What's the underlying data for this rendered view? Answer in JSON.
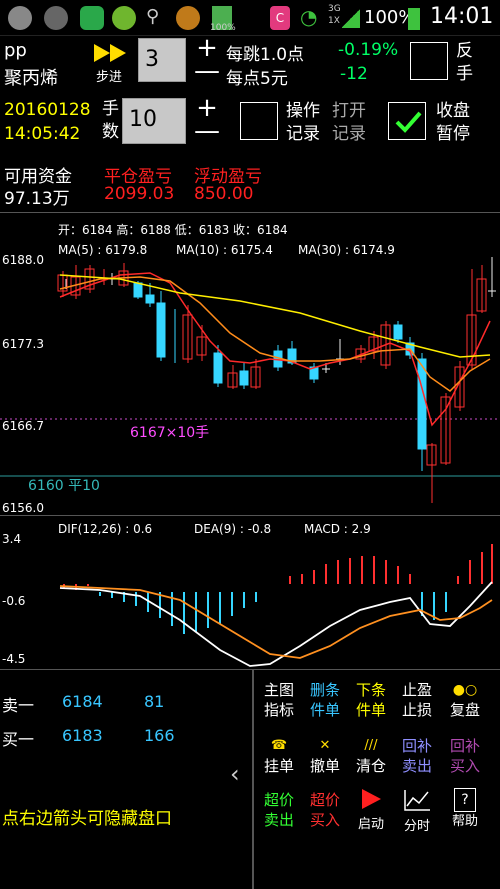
{
  "status_bar": {
    "battery_small": "100%",
    "network": "3G",
    "network_sub": "1X",
    "battery": "100%",
    "time": "14:01"
  },
  "header": {
    "symbol": "pp",
    "name": "聚丙烯",
    "step_label": "步进",
    "step_value": "3",
    "tick_info": "每跳1.0点",
    "point_info": "每点5元",
    "change_pct": "-0.19%",
    "change_abs": "-12",
    "reverse_label": "反\n手",
    "date": "20160128",
    "time": "14:05:42",
    "lots_label": "手\n数",
    "lots_value": "10",
    "op_record_label": "操作\n记录",
    "open_record_label": "打开\n记录",
    "pause_label": "收盘\n暂停"
  },
  "account": {
    "avail_label": "可用资金",
    "avail_value": "97.13万",
    "closed_pnl_label": "平仓盈亏",
    "closed_pnl_value": "2099.03",
    "float_pnl_label": "浮动盈亏",
    "float_pnl_value": "850.00"
  },
  "kline": {
    "ohlc": "开：6184    高：6188    低：6183    收：6184",
    "ma5": "MA(5) : 6179.8",
    "ma10": "MA(10) : 6175.4",
    "ma30": "MA(30) : 6174.9",
    "y_labels": [
      "6188.0",
      "6177.3",
      "6166.7",
      "6156.0"
    ],
    "position_label": "6167×10手",
    "close_label": "6160 平10"
  },
  "macd": {
    "dif": "DIF(12,26) : 0.6",
    "dea": "DEA(9) : -0.8",
    "macd": "MACD : 2.9",
    "y_labels": [
      "3.4",
      "-0.6",
      "-4.5"
    ]
  },
  "orderbook": {
    "ask_label": "卖一",
    "ask_price": "6184",
    "ask_vol": "81",
    "bid_label": "买一",
    "bid_price": "6183",
    "bid_vol": "166",
    "hint": "点右边箭头可隐藏盘口"
  },
  "buttons": {
    "main_indicator": "主图\n指标",
    "delete_order": "删条\n件单",
    "cond_order": "下条\n件单",
    "stop": "止盈\n止损",
    "replay": "复盘",
    "place_order": "挂单",
    "cancel_order": "撤单",
    "clear": "清仓",
    "back_sell": "回补\n卖出",
    "back_buy": "回补\n买入",
    "super_sell": "超价\n卖出",
    "super_buy": "超价\n买入",
    "start": "启动",
    "timeshare": "分时",
    "help": "帮助"
  }
}
